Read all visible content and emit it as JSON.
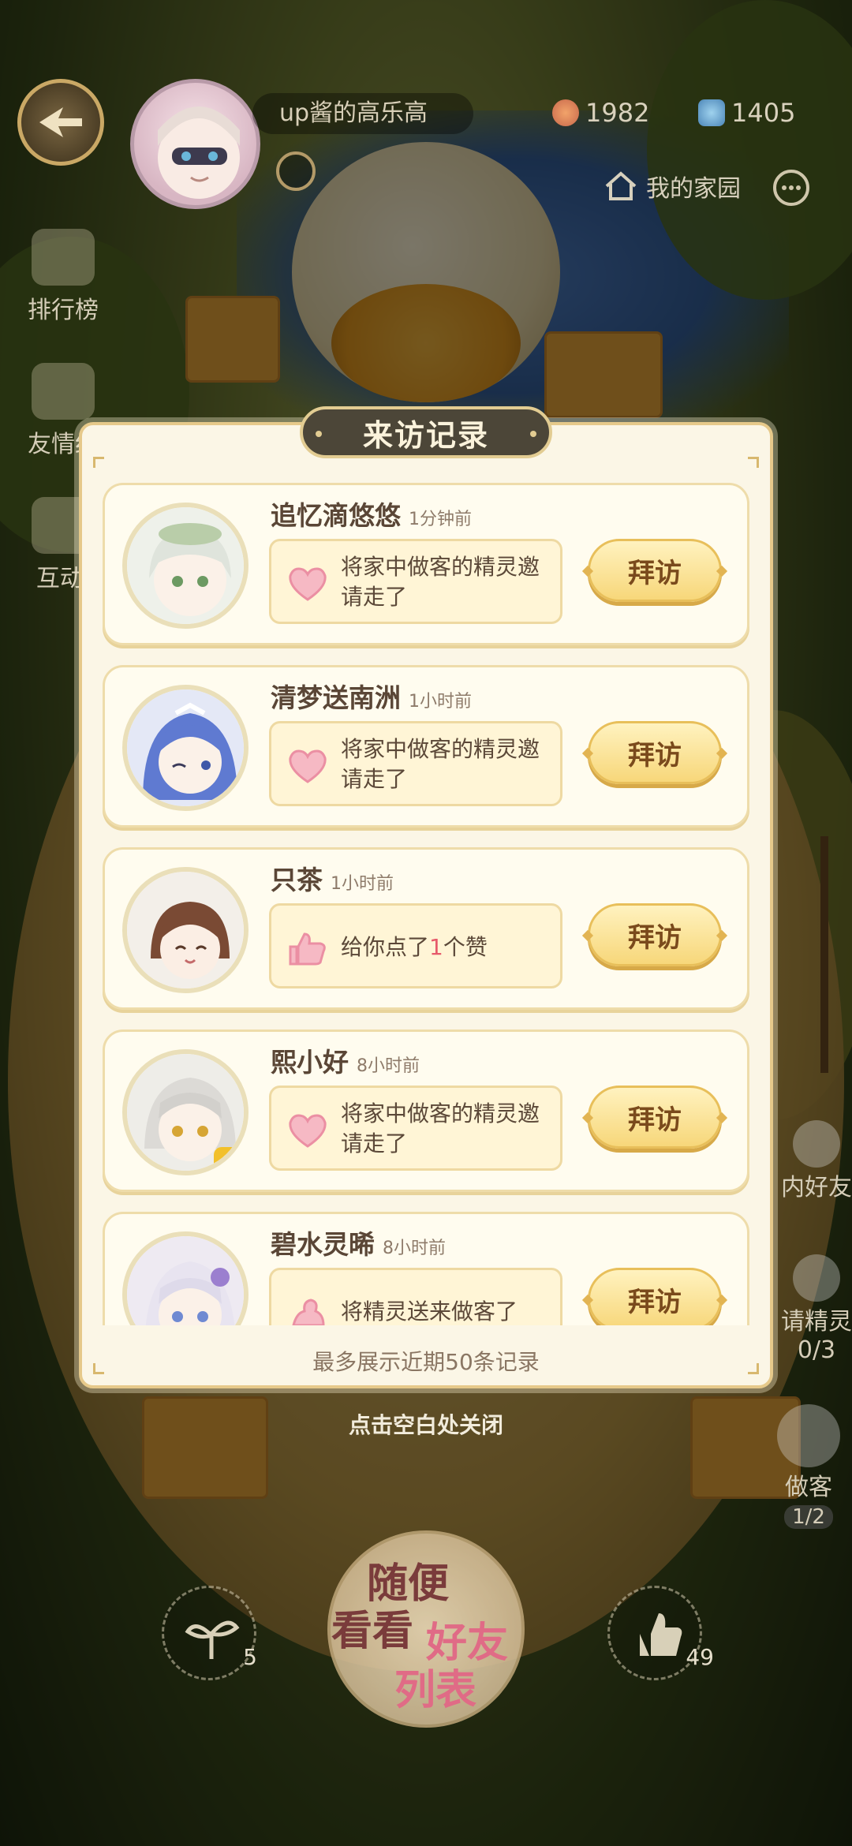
{
  "header": {
    "username": "up酱的高乐高",
    "currency_1": "1982",
    "currency_2": "1405",
    "home_label": "我的家园"
  },
  "left_menu": [
    {
      "label": "排行榜"
    },
    {
      "label": "友情纪"
    },
    {
      "label": "互动i"
    }
  ],
  "modal": {
    "title": "来访记录",
    "footer": "最多展示近期50条记录",
    "visit_label": "拜访",
    "records": [
      {
        "name": "追忆滴悠悠",
        "time": "1分钟前",
        "icon": "heart-icon",
        "text_lines": [
          "将家中做客的精灵邀",
          "请走了"
        ]
      },
      {
        "name": "清梦送南洲",
        "time": "1小时前",
        "icon": "heart-icon",
        "text_lines": [
          "将家中做客的精灵邀",
          "请走了"
        ]
      },
      {
        "name": "只茶",
        "time": "1小时前",
        "icon": "thumbs-up-icon",
        "text_before": "给你点了",
        "text_count": "1",
        "text_after": "个赞"
      },
      {
        "name": "熙小好",
        "time": "8小时前",
        "icon": "heart-icon",
        "text_lines": [
          "将家中做客的精灵邀",
          "请走了"
        ]
      },
      {
        "name": "碧水灵晞",
        "time": "8小时前",
        "icon": "spirit-icon",
        "text_lines": [
          "将精灵送来做客了",
          ""
        ]
      }
    ]
  },
  "close_hint": "点击空白处关闭",
  "right_menu": {
    "friend_label": "内好友",
    "invite_label": "请精灵",
    "invite_count": "0/3",
    "guest_label": "做客",
    "guest_count": "1/2"
  },
  "bottom": {
    "left_count": "5",
    "right_count": "49",
    "center_text_1": "随便",
    "center_text_2": "看看",
    "center_text_3": "好友",
    "center_text_4": "列表"
  },
  "colors": {
    "modal_bg": "#fbf6e6",
    "title_bg": "#4c4638",
    "visit_btn": "#f7d77a",
    "highlight": "#e65a6a"
  }
}
